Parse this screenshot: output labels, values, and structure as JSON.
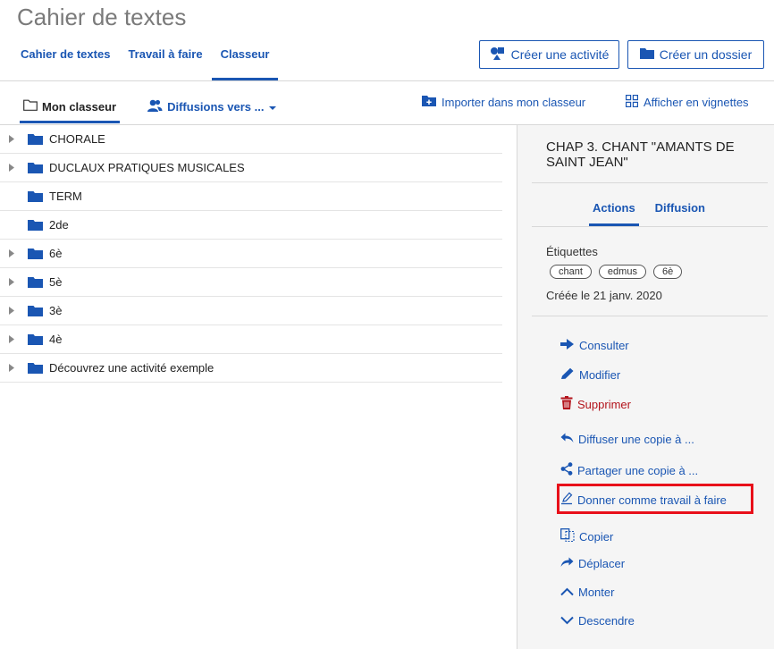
{
  "app": {
    "title": "Cahier de textes"
  },
  "top_tabs": [
    {
      "label": "Cahier de textes"
    },
    {
      "label": "Travail à faire"
    },
    {
      "label": "Classeur"
    }
  ],
  "buttons": {
    "create_activity": "Créer une activité",
    "create_folder": "Créer un dossier"
  },
  "sub_tabs": {
    "my_binder": "Mon classeur",
    "broadcasts": "Diffusions vers ..."
  },
  "tools": {
    "import": "Importer dans mon classeur",
    "thumbnails": "Afficher en vignettes"
  },
  "tree": [
    {
      "label": "CHORALE",
      "expandable": true
    },
    {
      "label": "DUCLAUX PRATIQUES MUSICALES",
      "expandable": true
    },
    {
      "label": "TERM",
      "expandable": false
    },
    {
      "label": "2de",
      "expandable": false
    },
    {
      "label": "6è",
      "expandable": true
    },
    {
      "label": "5è",
      "expandable": true
    },
    {
      "label": "3è",
      "expandable": true
    },
    {
      "label": "4è",
      "expandable": true
    },
    {
      "label": "Découvrez une activité exemple",
      "expandable": true
    }
  ],
  "panel": {
    "title": "CHAP 3. CHANT \"AMANTS DE SAINT JEAN\"",
    "tabs": {
      "actions": "Actions",
      "diffusion": "Diffusion"
    },
    "tags_label": "Étiquettes",
    "tags": [
      "chant",
      "edmus",
      "6è"
    ],
    "created": "Créée le 21 janv. 2020",
    "actions": {
      "view": "Consulter",
      "edit": "Modifier",
      "delete": "Supprimer",
      "broadcast_copy": "Diffuser une copie à ...",
      "share_copy": "Partager une copie à ...",
      "assign_homework": "Donner comme travail à faire",
      "copy": "Copier",
      "move": "Déplacer",
      "move_up": "Monter",
      "move_down": "Descendre"
    }
  },
  "colors": {
    "accent": "#1a56b3",
    "danger": "#b3141c",
    "highlight": "#e8101a"
  }
}
